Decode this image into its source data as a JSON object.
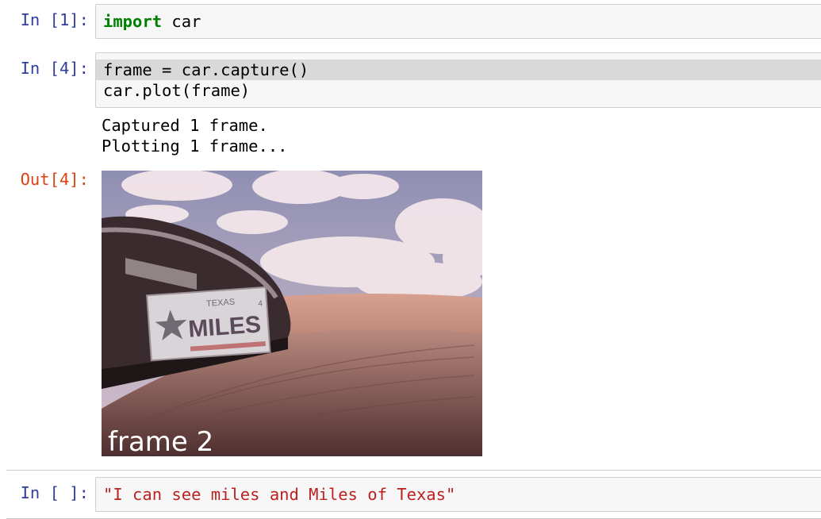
{
  "cells": [
    {
      "prompt": "In [1]:",
      "code": {
        "keyword": "import",
        "rest": " car"
      }
    },
    {
      "prompt": "In [4]:",
      "code_lines": [
        "frame = car.capture()",
        "car.plot(frame)"
      ],
      "stdout_lines": [
        "Captured 1 frame.",
        "Plotting 1 frame..."
      ],
      "out_prompt": "Out[4]:",
      "image": {
        "plate_state": "TEXAS",
        "plate_text": "MILES",
        "plate_number": "4",
        "caption": "frame 2"
      }
    },
    {
      "prompt": "In [ ]:",
      "code_string": "\"I can see miles and Miles of Texas\""
    }
  ],
  "colors": {
    "in_prompt": "#303f9f",
    "out_prompt": "#d84315",
    "keyword": "#008000",
    "string": "#ba2121",
    "cell_bg": "#f7f7f7",
    "selected_line": "#d9d9d9"
  }
}
